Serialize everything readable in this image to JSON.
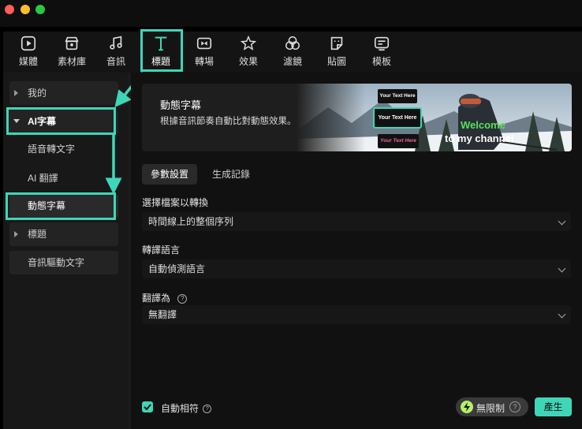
{
  "toolbar": {
    "items": [
      {
        "label": "媒體",
        "icon": "media-icon"
      },
      {
        "label": "素材庫",
        "icon": "store-icon"
      },
      {
        "label": "音訊",
        "icon": "music-note-icon"
      },
      {
        "label": "標題",
        "icon": "text-t-icon",
        "active": true
      },
      {
        "label": "轉場",
        "icon": "transition-icon"
      },
      {
        "label": "效果",
        "icon": "effects-star-icon"
      },
      {
        "label": "濾鏡",
        "icon": "filter-circles-icon"
      },
      {
        "label": "貼圖",
        "icon": "sticker-icon"
      },
      {
        "label": "模板",
        "icon": "template-icon"
      }
    ]
  },
  "sidebar": {
    "items": [
      {
        "label": "我的"
      },
      {
        "label": "AI字幕"
      },
      {
        "label": "語音轉文字"
      },
      {
        "label": "AI 翻譯"
      },
      {
        "label": "動態字幕"
      },
      {
        "label": "標題"
      },
      {
        "label": "音訊驅動文字"
      }
    ]
  },
  "banner": {
    "title": "動態字幕",
    "description": "根據音訊節奏自動比對動態效果。",
    "preview": {
      "chip1": "Your Text Here",
      "chip2": "Your Text Here",
      "chip3": "Your Text Here",
      "caption_line1": "Welcome",
      "caption_line2": "to my channel"
    }
  },
  "tabs": [
    {
      "label": "參數設置",
      "active": true
    },
    {
      "label": "生成記錄",
      "active": false
    }
  ],
  "form": {
    "file_label": "選擇檔案以轉換",
    "file_value": "時間線上的整個序列",
    "lang_label": "轉譯語言",
    "lang_value": "自動偵測語言",
    "translate_label": "翻譯為",
    "translate_value": "無翻譯"
  },
  "footer": {
    "auto_match_label": "自動相符",
    "unlimited_label": "無限制",
    "generate_label": "產生"
  },
  "colors": {
    "accent": "#3fd6b7",
    "highlight": "#f2e600",
    "caption_green": "#58e05a"
  }
}
